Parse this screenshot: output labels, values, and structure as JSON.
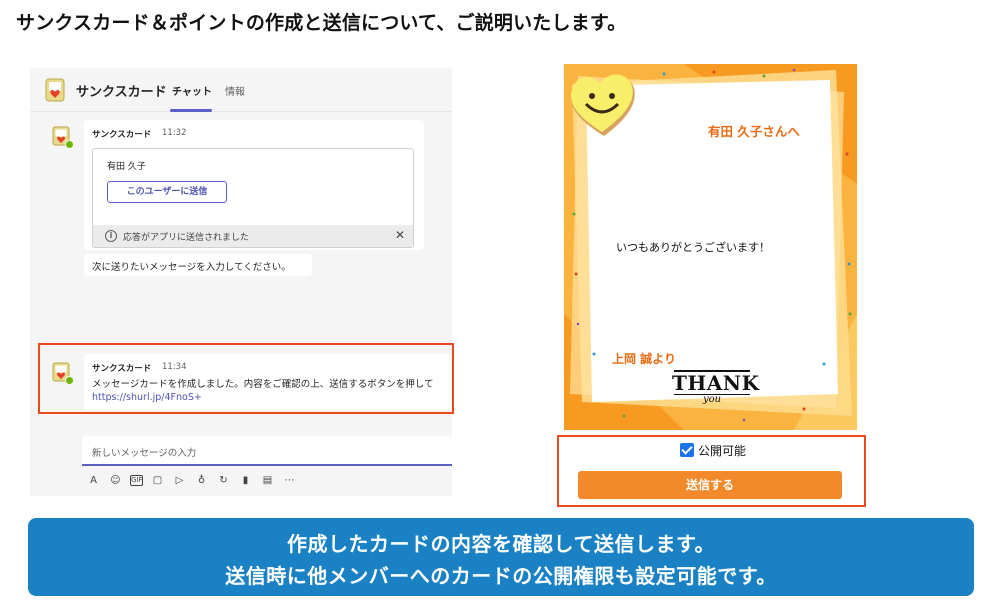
{
  "page": {
    "title": "サンクスカード＆ポイントの作成と送信について、ご説明いたします。"
  },
  "teams": {
    "header": {
      "app_name": "サンクスカード",
      "tabs": [
        {
          "label": "チャット",
          "active": true
        },
        {
          "label": "情報",
          "active": false
        }
      ],
      "accent_color": "#5b5fc7"
    },
    "message1": {
      "sender": "サンクスカード",
      "time": "11:32",
      "card": {
        "recipient": "有田 久子",
        "button_label": "このユーザーに送信",
        "footer_text": "応答がアプリに送信されました"
      }
    },
    "message1b": {
      "text": "次に送りたいメッセージを入力してください。"
    },
    "message2": {
      "sender": "サンクスカード",
      "time": "11:34",
      "text": "メッセージカードを作成しました。内容をご確認の上、送信するボタンを押して",
      "link": "https://shurl.jp/4FnoS+"
    },
    "compose": {
      "placeholder": "新しいメッセージの入力"
    },
    "toolbar_icons": [
      "format-icon",
      "emoji-icon",
      "gif-icon",
      "sticker-icon",
      "send-later-icon",
      "praise-icon",
      "loop-icon",
      "approvals-icon",
      "forms-icon",
      "more-icon"
    ]
  },
  "thank_card": {
    "to": "有田 久子さんへ",
    "message": "いつもありがとうございます！",
    "from": "上岡 誠より",
    "thank_big": "THANK",
    "thank_small": "you",
    "public_label": "公開可能",
    "public_checked": true,
    "send_label": "送信する",
    "colors": {
      "background": "#fbb340",
      "accent": "#e86a12",
      "button": "#f28a2b"
    }
  },
  "banner": {
    "line1": "作成したカードの内容を確認して送信します。",
    "line2": "送信時に他メンバーへのカードの公開権限も設定可能です。",
    "color": "#1a82c4"
  },
  "highlight_color": "#e8491d"
}
